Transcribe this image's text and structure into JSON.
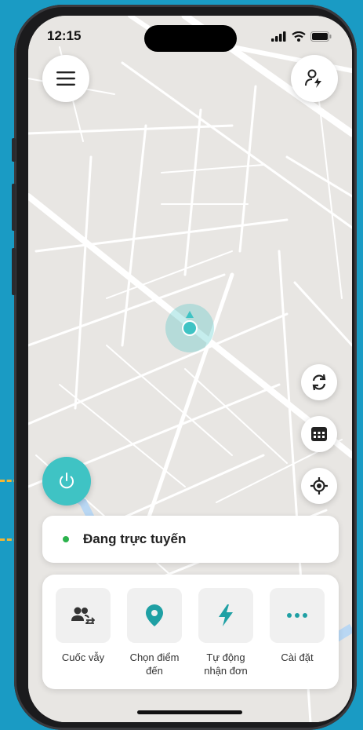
{
  "status_bar": {
    "time": "12:15",
    "icons": [
      "signal-icon",
      "wifi-icon",
      "battery-icon"
    ]
  },
  "header": {
    "menu_icon": "menu-icon",
    "profile_icon": "driver-profile-icon"
  },
  "map_controls": [
    "refresh-icon",
    "calendar-icon",
    "locate-icon"
  ],
  "power": {
    "icon": "power-icon",
    "color": "#3fc3c4"
  },
  "online_status": {
    "text": "Đang trực tuyến",
    "dot_color": "#2bb24c"
  },
  "actions": [
    {
      "icon": "passenger-transfer-icon",
      "label_line1": "Cuốc vẫy",
      "label_line2": ""
    },
    {
      "icon": "location-pin-icon",
      "label_line1": "Chọn điểm",
      "label_line2": "đến"
    },
    {
      "icon": "lightning-icon",
      "label_line1": "Tự động",
      "label_line2": "nhận đơn"
    },
    {
      "icon": "more-icon",
      "label_line1": "Cài đặt",
      "label_line2": ""
    }
  ],
  "colors": {
    "accent": "#3fc3c4",
    "background": "#1a9bc4",
    "annotation": "#f4b733"
  }
}
